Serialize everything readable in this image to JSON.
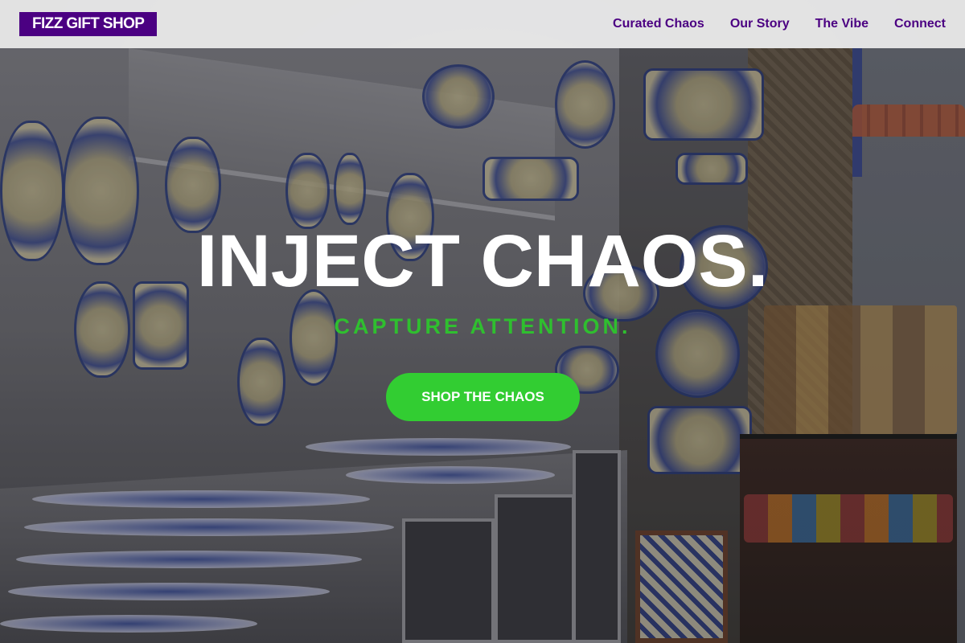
{
  "nav": {
    "logo": "FIZZ GIFT SHOP",
    "links": [
      "Curated Chaos",
      "Our Story",
      "The Vibe",
      "Connect"
    ]
  },
  "hero": {
    "headline": "INJECT CHAOS.",
    "subheadline": "CAPTURE ATTENTION.",
    "cta_label": "SHOP THE CHAOS"
  },
  "colors": {
    "brand_purple": "#4b0082",
    "accent_green": "#32cd32",
    "subhead_green": "#2fbf2f",
    "nav_bg": "#f0f0f0"
  }
}
